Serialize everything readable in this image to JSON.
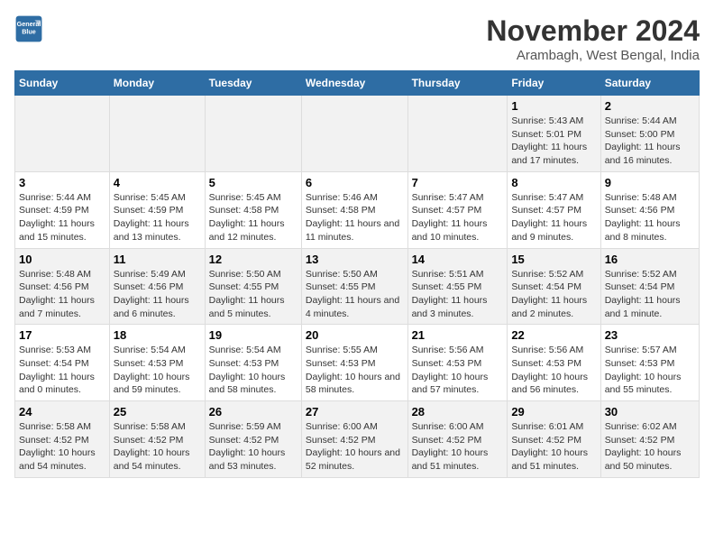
{
  "logo": {
    "line1": "General",
    "line2": "Blue"
  },
  "title": "November 2024",
  "subtitle": "Arambagh, West Bengal, India",
  "weekdays": [
    "Sunday",
    "Monday",
    "Tuesday",
    "Wednesday",
    "Thursday",
    "Friday",
    "Saturday"
  ],
  "weeks": [
    [
      {
        "day": "",
        "info": ""
      },
      {
        "day": "",
        "info": ""
      },
      {
        "day": "",
        "info": ""
      },
      {
        "day": "",
        "info": ""
      },
      {
        "day": "",
        "info": ""
      },
      {
        "day": "1",
        "info": "Sunrise: 5:43 AM\nSunset: 5:01 PM\nDaylight: 11 hours and 17 minutes."
      },
      {
        "day": "2",
        "info": "Sunrise: 5:44 AM\nSunset: 5:00 PM\nDaylight: 11 hours and 16 minutes."
      }
    ],
    [
      {
        "day": "3",
        "info": "Sunrise: 5:44 AM\nSunset: 4:59 PM\nDaylight: 11 hours and 15 minutes."
      },
      {
        "day": "4",
        "info": "Sunrise: 5:45 AM\nSunset: 4:59 PM\nDaylight: 11 hours and 13 minutes."
      },
      {
        "day": "5",
        "info": "Sunrise: 5:45 AM\nSunset: 4:58 PM\nDaylight: 11 hours and 12 minutes."
      },
      {
        "day": "6",
        "info": "Sunrise: 5:46 AM\nSunset: 4:58 PM\nDaylight: 11 hours and 11 minutes."
      },
      {
        "day": "7",
        "info": "Sunrise: 5:47 AM\nSunset: 4:57 PM\nDaylight: 11 hours and 10 minutes."
      },
      {
        "day": "8",
        "info": "Sunrise: 5:47 AM\nSunset: 4:57 PM\nDaylight: 11 hours and 9 minutes."
      },
      {
        "day": "9",
        "info": "Sunrise: 5:48 AM\nSunset: 4:56 PM\nDaylight: 11 hours and 8 minutes."
      }
    ],
    [
      {
        "day": "10",
        "info": "Sunrise: 5:48 AM\nSunset: 4:56 PM\nDaylight: 11 hours and 7 minutes."
      },
      {
        "day": "11",
        "info": "Sunrise: 5:49 AM\nSunset: 4:56 PM\nDaylight: 11 hours and 6 minutes."
      },
      {
        "day": "12",
        "info": "Sunrise: 5:50 AM\nSunset: 4:55 PM\nDaylight: 11 hours and 5 minutes."
      },
      {
        "day": "13",
        "info": "Sunrise: 5:50 AM\nSunset: 4:55 PM\nDaylight: 11 hours and 4 minutes."
      },
      {
        "day": "14",
        "info": "Sunrise: 5:51 AM\nSunset: 4:55 PM\nDaylight: 11 hours and 3 minutes."
      },
      {
        "day": "15",
        "info": "Sunrise: 5:52 AM\nSunset: 4:54 PM\nDaylight: 11 hours and 2 minutes."
      },
      {
        "day": "16",
        "info": "Sunrise: 5:52 AM\nSunset: 4:54 PM\nDaylight: 11 hours and 1 minute."
      }
    ],
    [
      {
        "day": "17",
        "info": "Sunrise: 5:53 AM\nSunset: 4:54 PM\nDaylight: 11 hours and 0 minutes."
      },
      {
        "day": "18",
        "info": "Sunrise: 5:54 AM\nSunset: 4:53 PM\nDaylight: 10 hours and 59 minutes."
      },
      {
        "day": "19",
        "info": "Sunrise: 5:54 AM\nSunset: 4:53 PM\nDaylight: 10 hours and 58 minutes."
      },
      {
        "day": "20",
        "info": "Sunrise: 5:55 AM\nSunset: 4:53 PM\nDaylight: 10 hours and 58 minutes."
      },
      {
        "day": "21",
        "info": "Sunrise: 5:56 AM\nSunset: 4:53 PM\nDaylight: 10 hours and 57 minutes."
      },
      {
        "day": "22",
        "info": "Sunrise: 5:56 AM\nSunset: 4:53 PM\nDaylight: 10 hours and 56 minutes."
      },
      {
        "day": "23",
        "info": "Sunrise: 5:57 AM\nSunset: 4:53 PM\nDaylight: 10 hours and 55 minutes."
      }
    ],
    [
      {
        "day": "24",
        "info": "Sunrise: 5:58 AM\nSunset: 4:52 PM\nDaylight: 10 hours and 54 minutes."
      },
      {
        "day": "25",
        "info": "Sunrise: 5:58 AM\nSunset: 4:52 PM\nDaylight: 10 hours and 54 minutes."
      },
      {
        "day": "26",
        "info": "Sunrise: 5:59 AM\nSunset: 4:52 PM\nDaylight: 10 hours and 53 minutes."
      },
      {
        "day": "27",
        "info": "Sunrise: 6:00 AM\nSunset: 4:52 PM\nDaylight: 10 hours and 52 minutes."
      },
      {
        "day": "28",
        "info": "Sunrise: 6:00 AM\nSunset: 4:52 PM\nDaylight: 10 hours and 51 minutes."
      },
      {
        "day": "29",
        "info": "Sunrise: 6:01 AM\nSunset: 4:52 PM\nDaylight: 10 hours and 51 minutes."
      },
      {
        "day": "30",
        "info": "Sunrise: 6:02 AM\nSunset: 4:52 PM\nDaylight: 10 hours and 50 minutes."
      }
    ]
  ]
}
